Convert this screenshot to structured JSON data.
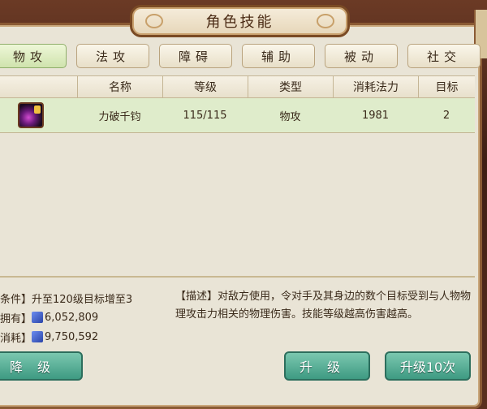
{
  "window": {
    "title": "角色技能"
  },
  "tabs": [
    {
      "label": "物攻",
      "active": true
    },
    {
      "label": "法攻",
      "active": false
    },
    {
      "label": "障碍",
      "active": false
    },
    {
      "label": "辅助",
      "active": false
    },
    {
      "label": "被动",
      "active": false
    },
    {
      "label": "社交",
      "active": false
    }
  ],
  "table": {
    "headers": [
      "名称",
      "等级",
      "类型",
      "消耗法力",
      "目标"
    ],
    "rows": [
      {
        "icon": "skill-icon",
        "name": "力破千钧",
        "level": "115/115",
        "type": "物攻",
        "mana": "1981",
        "target": "2"
      }
    ]
  },
  "info": {
    "condition": "条件】升至120级目标增至3",
    "own_label": "拥有】",
    "own_value": "6,052,809",
    "cost_label": "消耗】",
    "cost_value": "9,750,592",
    "currency_icon": "book-coin-icon"
  },
  "description": "【描述】对敌方使用，令对手及其身边的数个目标受到与人物物理攻击力相关的物理伤害。技能等级越高伤害越高。",
  "buttons": {
    "downgrade": "降级",
    "upgrade": "升级",
    "upgrade10": "升级10次"
  },
  "colors": {
    "panel_bg": "#e9e4d6",
    "row_selected": "#dfeccb",
    "button_teal": "#3e9a82",
    "border_brown": "#8a5a34"
  }
}
